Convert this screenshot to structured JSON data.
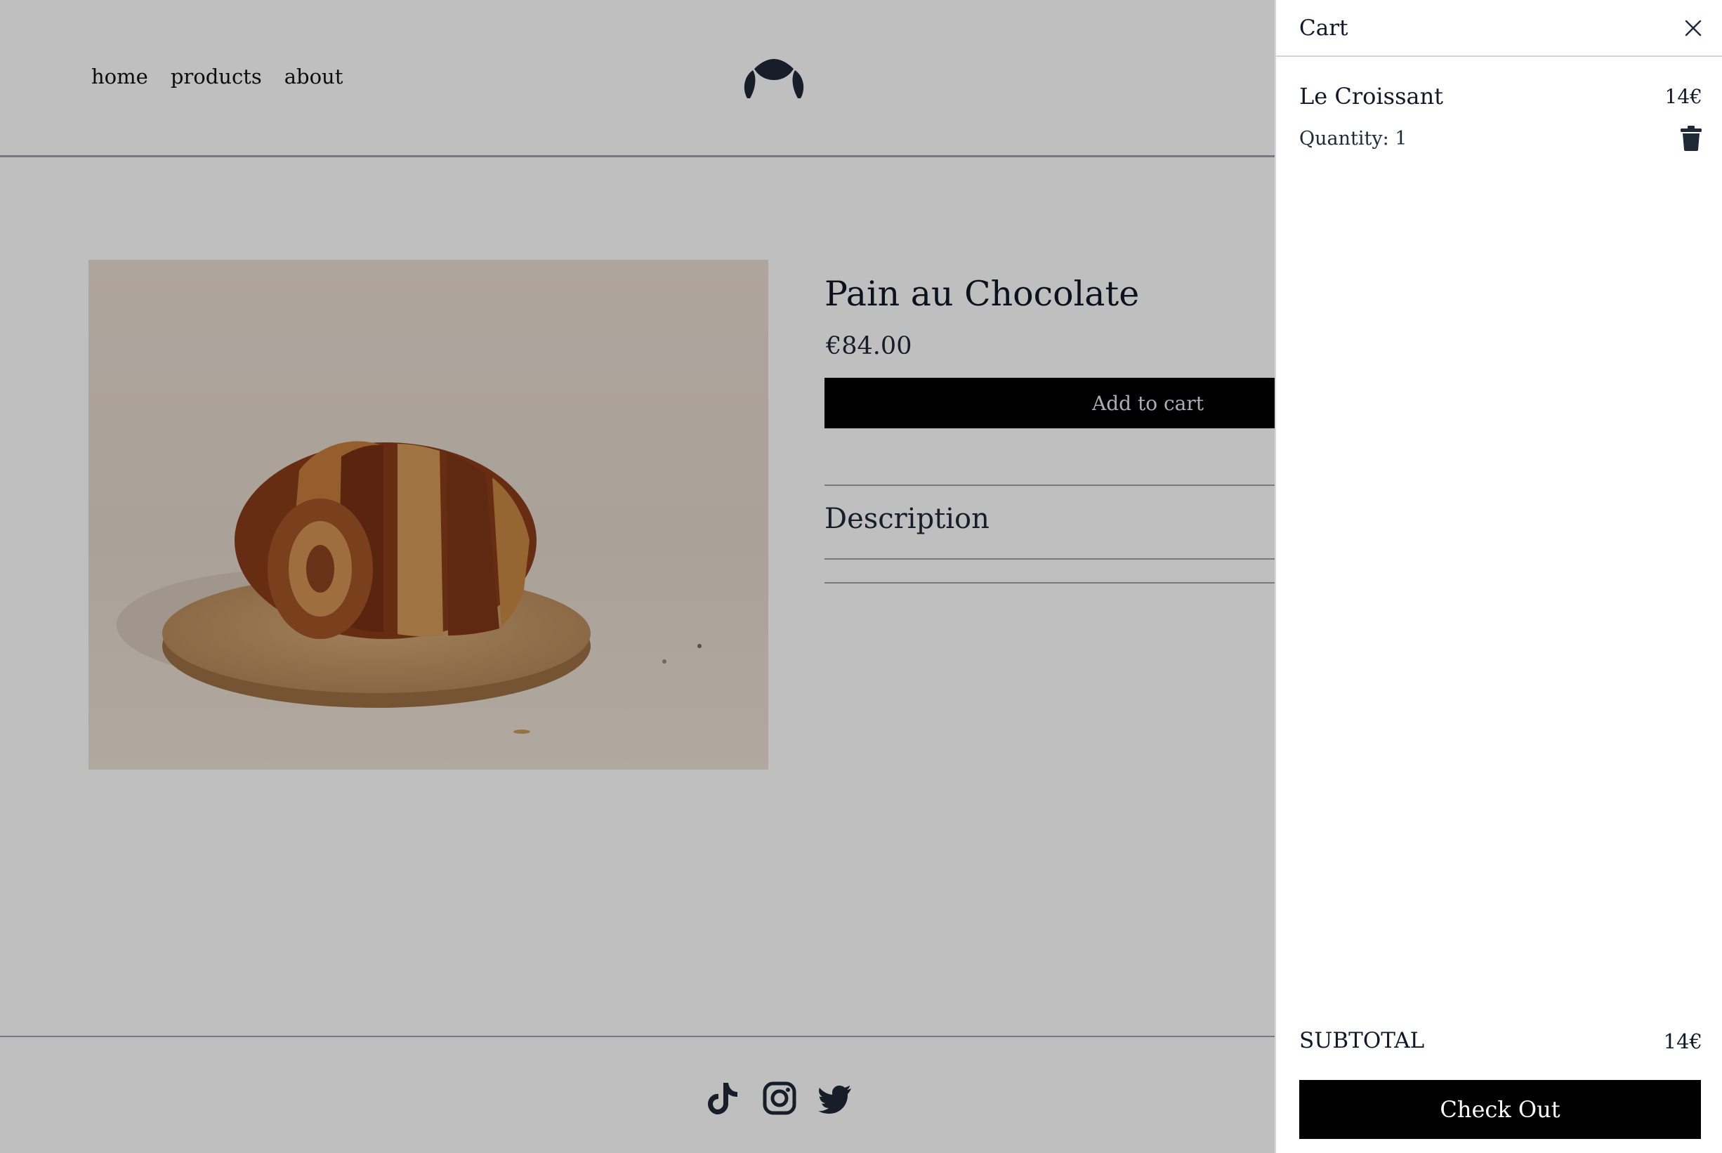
{
  "nav": {
    "items": [
      "home",
      "products",
      "about"
    ]
  },
  "logo": {
    "icon": "croissant-logo-icon"
  },
  "product": {
    "title": "Pain au Chocolate",
    "price": "€84.00",
    "add_to_cart_label": "Add to cart",
    "description_label": "Description"
  },
  "footer": {
    "social_icons": [
      "tiktok-icon",
      "instagram-icon",
      "twitter-icon"
    ]
  },
  "cart": {
    "title": "Cart",
    "items": [
      {
        "name": "Le Croissant",
        "price": "14€",
        "quantity": "Quantity: 1"
      }
    ],
    "subtotal_label": "SUBTOTAL",
    "subtotal_value": "14€",
    "checkout_label": "Check Out"
  },
  "colors": {
    "overlay": "#bfbfbf",
    "button": "#000000",
    "text": "#1f2937"
  }
}
